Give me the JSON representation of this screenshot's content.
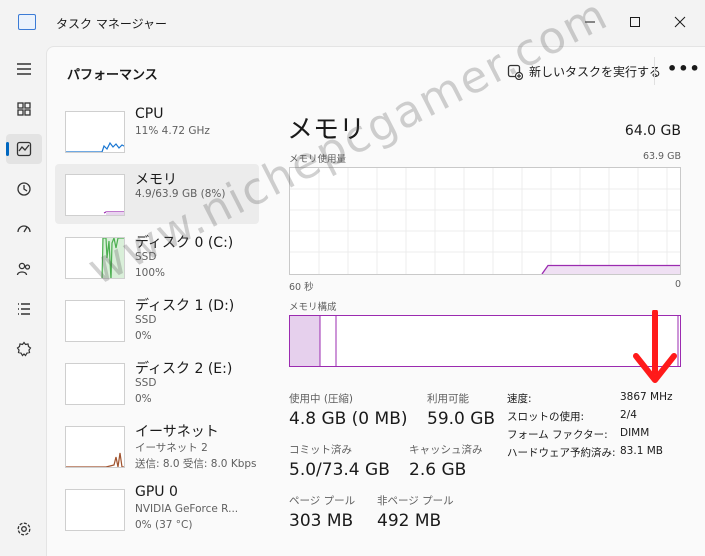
{
  "window": {
    "title": "タスク マネージャー"
  },
  "header": {
    "page_title": "パフォーマンス",
    "run_new_task": "新しいタスクを実行する",
    "more": "•••"
  },
  "colors": {
    "accent": "#0067c0",
    "memory": "#9b2bb0",
    "cpu": "#1976d2",
    "disk": "#4caf50",
    "ethernet": "#a0522d"
  },
  "nav_icons": [
    "hamburger-icon",
    "processes-icon",
    "performance-icon",
    "history-icon",
    "startup-icon",
    "users-icon",
    "details-icon",
    "services-icon",
    "settings-icon"
  ],
  "list": [
    {
      "name": "CPU",
      "sub1": "11%  4.72 GHz",
      "sub2": ""
    },
    {
      "name": "メモリ",
      "sub1": "4.9/63.9 GB (8%)",
      "sub2": ""
    },
    {
      "name": "ディスク 0 (C:)",
      "sub1": "SSD",
      "sub2": "100%"
    },
    {
      "name": "ディスク 1 (D:)",
      "sub1": "SSD",
      "sub2": "0%"
    },
    {
      "name": "ディスク 2 (E:)",
      "sub1": "SSD",
      "sub2": "0%"
    },
    {
      "name": "イーサネット",
      "sub1": "イーサネット 2",
      "sub2": "送信: 8.0 受信: 8.0 Kbps"
    },
    {
      "name": "GPU 0",
      "sub1": "NVIDIA GeForce R...",
      "sub2": "0% (37 °C)"
    }
  ],
  "detail": {
    "title": "メモリ",
    "total": "64.0 GB",
    "usage_label": "メモリ使用量",
    "usage_max": "63.9 GB",
    "axis_left": "60 秒",
    "axis_right": "0",
    "composition_label": "メモリ構成",
    "usage_fraction": 0.08,
    "stats": {
      "in_use_label": "使用中 (圧縮)",
      "in_use": "4.8 GB (0 MB)",
      "available_label": "利用可能",
      "available": "59.0 GB",
      "committed_label": "コミット済み",
      "committed": "5.0/73.4 GB",
      "cached_label": "キャッシュ済み",
      "cached": "2.6 GB",
      "paged_label": "ページ プール",
      "paged": "303 MB",
      "nonpaged_label": "非ページ プール",
      "nonpaged": "492 MB"
    },
    "specs": [
      {
        "label": "速度:",
        "value": "3867 MHz"
      },
      {
        "label": "スロットの使用:",
        "value": "2/4"
      },
      {
        "label": "フォーム ファクター:",
        "value": "DIMM"
      },
      {
        "label": "ハードウェア予約済み:",
        "value": "83.1 MB"
      }
    ]
  },
  "watermark": "www.nichepcgamer.com"
}
